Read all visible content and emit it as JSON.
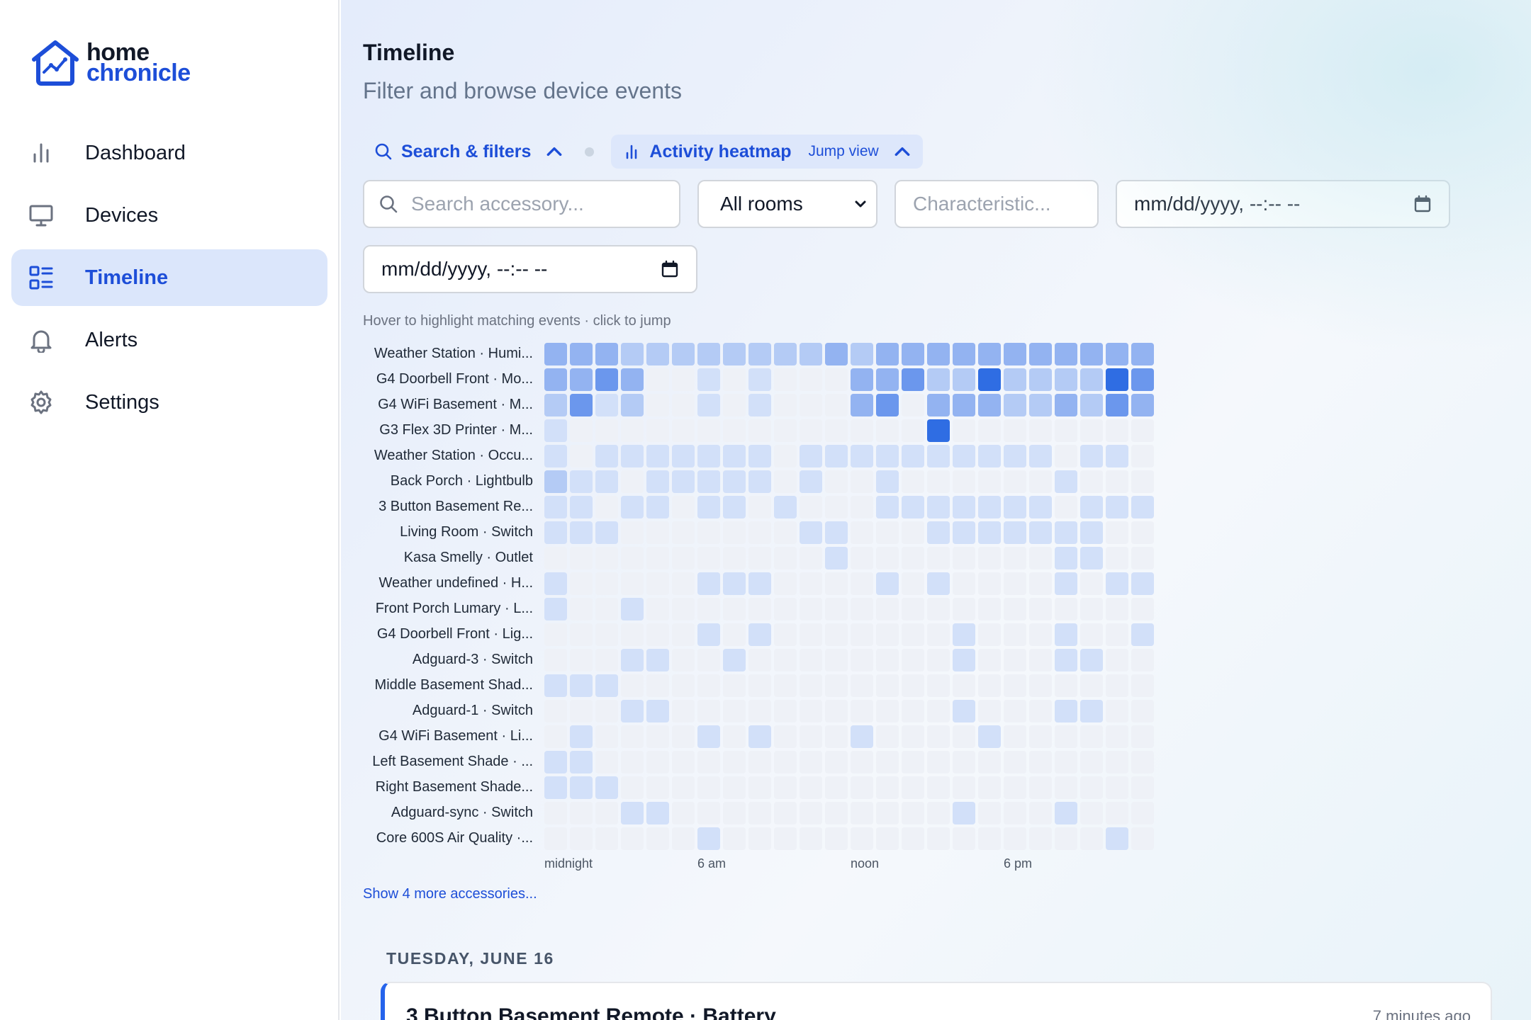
{
  "app": {
    "logo_line1": "home",
    "logo_line2": "chronicle"
  },
  "sidebar": {
    "items": [
      {
        "label": "Dashboard",
        "icon": "bar-chart-icon",
        "active": false
      },
      {
        "label": "Devices",
        "icon": "monitor-icon",
        "active": false
      },
      {
        "label": "Timeline",
        "icon": "list-icon",
        "active": true
      },
      {
        "label": "Alerts",
        "icon": "bell-icon",
        "active": false
      },
      {
        "label": "Settings",
        "icon": "gear-icon",
        "active": false
      }
    ]
  },
  "header": {
    "title": "Timeline",
    "subtitle": "Filter and browse device events"
  },
  "tabs": {
    "filters": {
      "label": "Search & filters",
      "icon": "search-icon"
    },
    "heatmap": {
      "label": "Activity heatmap",
      "badge": "Jump view",
      "icon": "bar-chart-icon"
    }
  },
  "filters": {
    "search_placeholder": "Search accessory...",
    "room_value": "All rooms",
    "room_options": [
      "All rooms"
    ],
    "characteristic_placeholder": "Characteristic...",
    "date_from_placeholder": "mm/dd/yyyy, --:-- --",
    "date_to_placeholder": "mm/dd/yyyy, --:-- --"
  },
  "heatmap": {
    "hint": "Hover to highlight matching events · click to jump",
    "axis_labels": [
      "midnight",
      "6 am",
      "noon",
      "6 pm"
    ],
    "level_colors": [
      "#eef1f7",
      "#d2e0f9",
      "#b4cbf5",
      "#93b3f1",
      "#6b97ed",
      "#2f6de3"
    ],
    "rows": [
      {
        "label": "Weather Station · Humi...",
        "levels": [
          3,
          3,
          3,
          2,
          2,
          2,
          2,
          2,
          2,
          2,
          2,
          3,
          2,
          3,
          3,
          3,
          3,
          3,
          3,
          3,
          3,
          3,
          3,
          3
        ]
      },
      {
        "label": "G4 Doorbell Front · Mo...",
        "levels": [
          3,
          3,
          4,
          3,
          0,
          0,
          1,
          0,
          1,
          0,
          0,
          0,
          3,
          3,
          4,
          2,
          2,
          5,
          2,
          2,
          2,
          2,
          5,
          4
        ]
      },
      {
        "label": "G4 WiFi Basement · M...",
        "levels": [
          2,
          4,
          1,
          2,
          0,
          0,
          1,
          0,
          1,
          0,
          0,
          0,
          3,
          4,
          0,
          3,
          3,
          3,
          2,
          2,
          3,
          2,
          4,
          3
        ]
      },
      {
        "label": "G3 Flex 3D Printer · M...",
        "levels": [
          1,
          0,
          0,
          0,
          0,
          0,
          0,
          0,
          0,
          0,
          0,
          0,
          0,
          0,
          0,
          5,
          0,
          0,
          0,
          0,
          0,
          0,
          0,
          0
        ]
      },
      {
        "label": "Weather Station · Occu...",
        "levels": [
          1,
          0,
          1,
          1,
          1,
          1,
          1,
          1,
          1,
          0,
          1,
          1,
          1,
          1,
          1,
          1,
          1,
          1,
          1,
          1,
          0,
          1,
          1,
          0
        ]
      },
      {
        "label": "Back Porch · Lightbulb",
        "levels": [
          2,
          1,
          1,
          0,
          1,
          1,
          1,
          1,
          1,
          0,
          1,
          0,
          0,
          1,
          0,
          0,
          0,
          0,
          0,
          0,
          1,
          0,
          0,
          0
        ]
      },
      {
        "label": "3 Button Basement Re...",
        "levels": [
          1,
          1,
          0,
          1,
          1,
          0,
          1,
          1,
          0,
          1,
          0,
          0,
          0,
          1,
          1,
          1,
          1,
          1,
          1,
          1,
          0,
          1,
          1,
          1
        ]
      },
      {
        "label": "Living Room · Switch",
        "levels": [
          1,
          1,
          1,
          0,
          0,
          0,
          0,
          0,
          0,
          0,
          1,
          1,
          0,
          0,
          0,
          1,
          1,
          1,
          1,
          1,
          1,
          1,
          0,
          0
        ]
      },
      {
        "label": "Kasa Smelly · Outlet",
        "levels": [
          0,
          0,
          0,
          0,
          0,
          0,
          0,
          0,
          0,
          0,
          0,
          1,
          0,
          0,
          0,
          0,
          0,
          0,
          0,
          0,
          1,
          1,
          0,
          0
        ]
      },
      {
        "label": "Weather undefined · H...",
        "levels": [
          1,
          0,
          0,
          0,
          0,
          0,
          1,
          1,
          1,
          0,
          0,
          0,
          0,
          1,
          0,
          1,
          0,
          0,
          0,
          0,
          1,
          0,
          1,
          1
        ]
      },
      {
        "label": "Front Porch Lumary · L...",
        "levels": [
          1,
          0,
          0,
          1,
          0,
          0,
          0,
          0,
          0,
          0,
          0,
          0,
          0,
          0,
          0,
          0,
          0,
          0,
          0,
          0,
          0,
          0,
          0,
          0
        ]
      },
      {
        "label": "G4 Doorbell Front · Lig...",
        "levels": [
          0,
          0,
          0,
          0,
          0,
          0,
          1,
          0,
          1,
          0,
          0,
          0,
          0,
          0,
          0,
          0,
          1,
          0,
          0,
          0,
          1,
          0,
          0,
          1
        ]
      },
      {
        "label": "Adguard-3 · Switch",
        "levels": [
          0,
          0,
          0,
          1,
          1,
          0,
          0,
          1,
          0,
          0,
          0,
          0,
          0,
          0,
          0,
          0,
          1,
          0,
          0,
          0,
          1,
          1,
          0,
          0
        ]
      },
      {
        "label": "Middle Basement Shad...",
        "levels": [
          1,
          1,
          1,
          0,
          0,
          0,
          0,
          0,
          0,
          0,
          0,
          0,
          0,
          0,
          0,
          0,
          0,
          0,
          0,
          0,
          0,
          0,
          0,
          0
        ]
      },
      {
        "label": "Adguard-1 · Switch",
        "levels": [
          0,
          0,
          0,
          1,
          1,
          0,
          0,
          0,
          0,
          0,
          0,
          0,
          0,
          0,
          0,
          0,
          1,
          0,
          0,
          0,
          1,
          1,
          0,
          0
        ]
      },
      {
        "label": "G4 WiFi Basement · Li...",
        "levels": [
          0,
          1,
          0,
          0,
          0,
          0,
          1,
          0,
          1,
          0,
          0,
          0,
          1,
          0,
          0,
          0,
          0,
          1,
          0,
          0,
          0,
          0,
          0,
          0
        ]
      },
      {
        "label": "Left Basement Shade · ...",
        "levels": [
          1,
          1,
          0,
          0,
          0,
          0,
          0,
          0,
          0,
          0,
          0,
          0,
          0,
          0,
          0,
          0,
          0,
          0,
          0,
          0,
          0,
          0,
          0,
          0
        ]
      },
      {
        "label": "Right Basement Shade...",
        "levels": [
          1,
          1,
          1,
          0,
          0,
          0,
          0,
          0,
          0,
          0,
          0,
          0,
          0,
          0,
          0,
          0,
          0,
          0,
          0,
          0,
          0,
          0,
          0,
          0
        ]
      },
      {
        "label": "Adguard-sync · Switch",
        "levels": [
          0,
          0,
          0,
          1,
          1,
          0,
          0,
          0,
          0,
          0,
          0,
          0,
          0,
          0,
          0,
          0,
          1,
          0,
          0,
          0,
          1,
          0,
          0,
          0
        ]
      },
      {
        "label": "Core 600S Air Quality ·...",
        "levels": [
          0,
          0,
          0,
          0,
          0,
          0,
          1,
          0,
          0,
          0,
          0,
          0,
          0,
          0,
          0,
          0,
          0,
          0,
          0,
          0,
          0,
          0,
          1,
          0
        ]
      }
    ],
    "more_link": "Show 4 more accessories..."
  },
  "events": {
    "day_header": "TUESDAY, JUNE 16",
    "items": [
      {
        "title": "3 Button Basement Remote · Battery",
        "time": "7 minutes ago"
      }
    ]
  }
}
